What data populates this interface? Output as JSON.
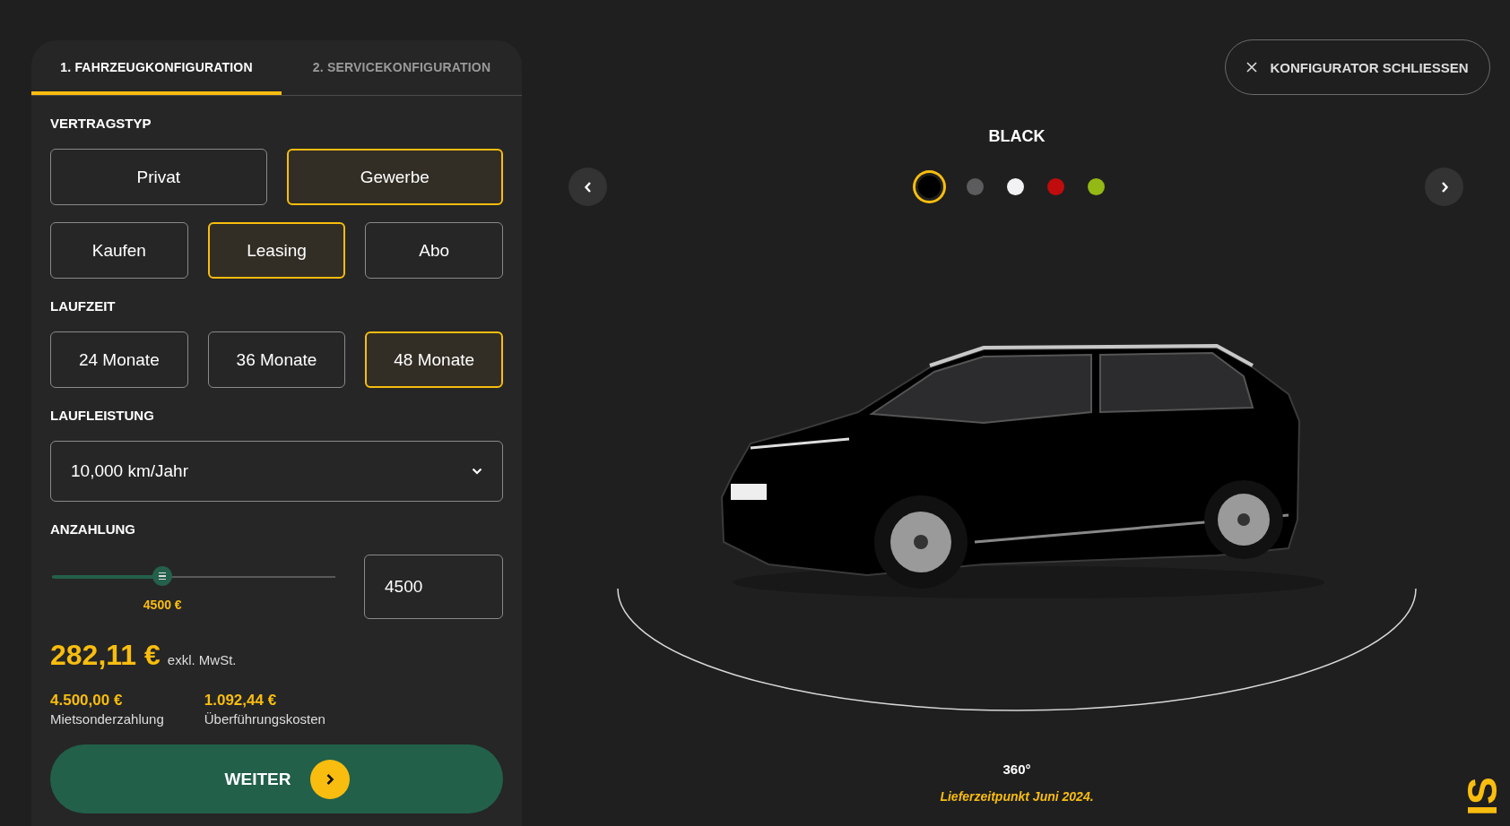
{
  "tabs": [
    {
      "label": "1. FAHRZEUGKONFIGURATION",
      "selected": true
    },
    {
      "label": "2. SERVICEKONFIGURATION",
      "selected": false
    }
  ],
  "vertragstyp": {
    "title": "VERTRAGSTYP",
    "customer_types": [
      {
        "label": "Privat",
        "selected": false
      },
      {
        "label": "Gewerbe",
        "selected": true
      }
    ],
    "contract_types": [
      {
        "label": "Kaufen",
        "selected": false
      },
      {
        "label": "Leasing",
        "selected": true
      },
      {
        "label": "Abo",
        "selected": false
      }
    ]
  },
  "laufzeit": {
    "title": "LAUFZEIT",
    "options": [
      {
        "label": "24 Monate",
        "selected": false
      },
      {
        "label": "36 Monate",
        "selected": false
      },
      {
        "label": "48 Monate",
        "selected": true
      }
    ]
  },
  "laufleistung": {
    "title": "LAUFLEISTUNG",
    "value": "10,000 km/Jahr"
  },
  "anzahlung": {
    "title": "ANZAHLUNG",
    "level": 0.39,
    "reading": "4500 €",
    "value": "4500"
  },
  "price": {
    "amount": "282,11 €",
    "note": "exkl. MwSt."
  },
  "costs": [
    {
      "amount": "4.500,00 €",
      "label": "Mietsonderzahlung"
    },
    {
      "amount": "1.092,44 €",
      "label": "Überführungskosten"
    }
  ],
  "next_button": {
    "label": "WEITER"
  },
  "close_button": {
    "label": "KONFIGURATOR SCHLIESSEN"
  },
  "color_name": "BLACK",
  "colors": [
    {
      "color": "#000000",
      "selected": true
    },
    {
      "color": "#5c5c5e",
      "selected": false
    },
    {
      "color": "#f2f2f4",
      "selected": false
    },
    {
      "color": "#c00c0c",
      "selected": false
    },
    {
      "color": "#94b814",
      "selected": false
    }
  ],
  "view_label": "360°",
  "delivery_note": "Lieferzeitpunkt Juni 2024.",
  "logo": "IS"
}
